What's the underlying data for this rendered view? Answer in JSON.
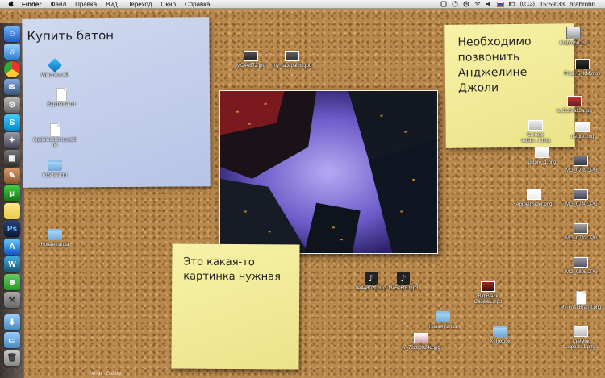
{
  "menubar": {
    "app_name": "Finder",
    "menus": [
      "Файл",
      "Правка",
      "Вид",
      "Переход",
      "Окно",
      "Справка"
    ],
    "battery": "(0:13)",
    "clock": "15:59:33",
    "user": "brabrobri"
  },
  "notes": {
    "blue": "Купить батон",
    "yellow_top": "Необходимо\nпозвонить\nАнджелине\nДжоли",
    "yellow_bottom": "Это какая-то\nкартинка нужная"
  },
  "icons": [
    {
      "label": "Windows XP",
      "kind": "cube"
    },
    {
      "label": "Zapmetka.txt",
      "kind": "doc"
    },
    {
      "label": "AppleInsider.ru.webloc",
      "kind": "doc"
    },
    {
      "label": "rozetked.ru",
      "kind": "folder"
    },
    {
      "label": "Новая папка",
      "kind": "folder"
    },
    {
      "label": "MC44872.jpg",
      "kind": "thumb"
    },
    {
      "label": "my_facepalms.jpg",
      "kind": "thumb"
    },
    {
      "label": "8e44802f.mp3",
      "kind": "music"
    },
    {
      "label": "f3e5e6f8.mp3",
      "kind": "music"
    },
    {
      "label": "Big Black Cadillac.mp3",
      "kind": "thumb"
    },
    {
      "label": "Новая папка",
      "kind": "folder"
    },
    {
      "label": "Xeroxbox",
      "kind": "folder"
    },
    {
      "label": "w_782b0024d.jpg",
      "kind": "thumb"
    },
    {
      "label": "brabrobri_dir",
      "kind": "drive"
    },
    {
      "label": "Final_5_KM.mov",
      "kind": "thumb"
    },
    {
      "label": "w_5cd7a13a.jpg",
      "kind": "thumb"
    },
    {
      "label": "Снимок экран...7.png",
      "kind": "thumb"
    },
    {
      "label": "ustore.png",
      "kind": "thumb"
    },
    {
      "label": "ustore_1.png",
      "kind": "thumb"
    },
    {
      "label": "IMG_0739.JPG",
      "kind": "thumb"
    },
    {
      "label": "AppleInsider.png",
      "kind": "thumb"
    },
    {
      "label": "IMG_0740.JPG",
      "kind": "thumb"
    },
    {
      "label": "IMG_0742.JPG",
      "kind": "thumb"
    },
    {
      "label": "IMG_0805.JPG",
      "kind": "thumb"
    },
    {
      "label": "My-Frist Brand.png",
      "kind": "doc"
    },
    {
      "label": "Снимок экран...1.png",
      "kind": "thumb"
    }
  ],
  "bottom_strip": "Skitch - Galaxy"
}
